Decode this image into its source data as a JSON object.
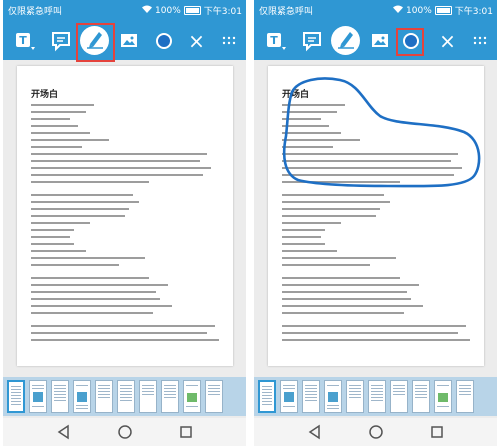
{
  "status": {
    "carrier": "仅限紧急呼叫",
    "battery": "100%",
    "time": "下午3:01"
  },
  "toolbar": {
    "close_label": "×"
  },
  "document": {
    "title": "开场白"
  },
  "colors": {
    "bar": "#2f97d3",
    "highlight": "#e5433c",
    "ink": "#1e6fc4"
  }
}
